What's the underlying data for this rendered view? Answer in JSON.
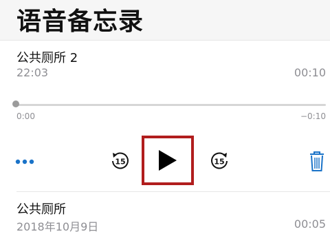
{
  "header": {
    "title": "语音备忘录"
  },
  "recordings": [
    {
      "title": "公共厕所 2",
      "time": "22:03",
      "duration": "00:10",
      "scrubber": {
        "elapsed": "0:00",
        "remaining": "−0:10"
      }
    },
    {
      "title": "公共厕所",
      "date": "2018年10月9日",
      "duration": "00:05"
    }
  ],
  "controls": {
    "more_icon": "more-dots-icon",
    "skip_back_icon": "skip-back-15-icon",
    "skip_back_seconds": "15",
    "play_icon": "play-icon",
    "skip_forward_icon": "skip-forward-15-icon",
    "skip_forward_seconds": "15",
    "delete_icon": "trash-icon"
  },
  "colors": {
    "accent": "#1a73c8",
    "highlight_box": "#b11d1d",
    "secondary_text": "#8e8e93"
  }
}
